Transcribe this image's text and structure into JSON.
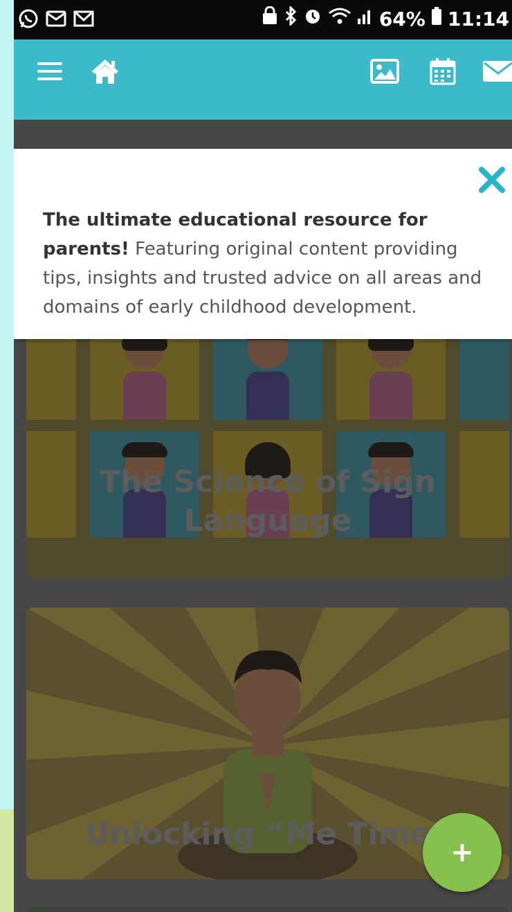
{
  "status_bar": {
    "battery_percent": "64%",
    "time": "11:14",
    "icons_left": [
      "whatsapp-icon",
      "mail-outline-icon",
      "gmail-icon"
    ],
    "icons_right": [
      "lock-icon",
      "bluetooth-icon",
      "alarm-icon",
      "wifi-icon",
      "signal-icon",
      "battery-icon"
    ]
  },
  "app_bar": {
    "color": "#3bbac9",
    "left_icons": [
      "menu-icon",
      "home-icon"
    ],
    "right_icons": [
      "image-icon",
      "calendar-icon",
      "mail-icon"
    ]
  },
  "popup": {
    "bold_text": "The ultimate educational resource for parents!",
    "body_text": " Featuring original content providing tips, insights and trusted advice on all areas and domains of early childhood development.",
    "close_icon": "close-icon",
    "close_color": "#2ab3c9"
  },
  "cards": [
    {
      "title": "The Science of Sign Language"
    },
    {
      "title": "Unlocking “Me Time”"
    }
  ],
  "fab": {
    "label": "+",
    "color": "#86c04d"
  }
}
